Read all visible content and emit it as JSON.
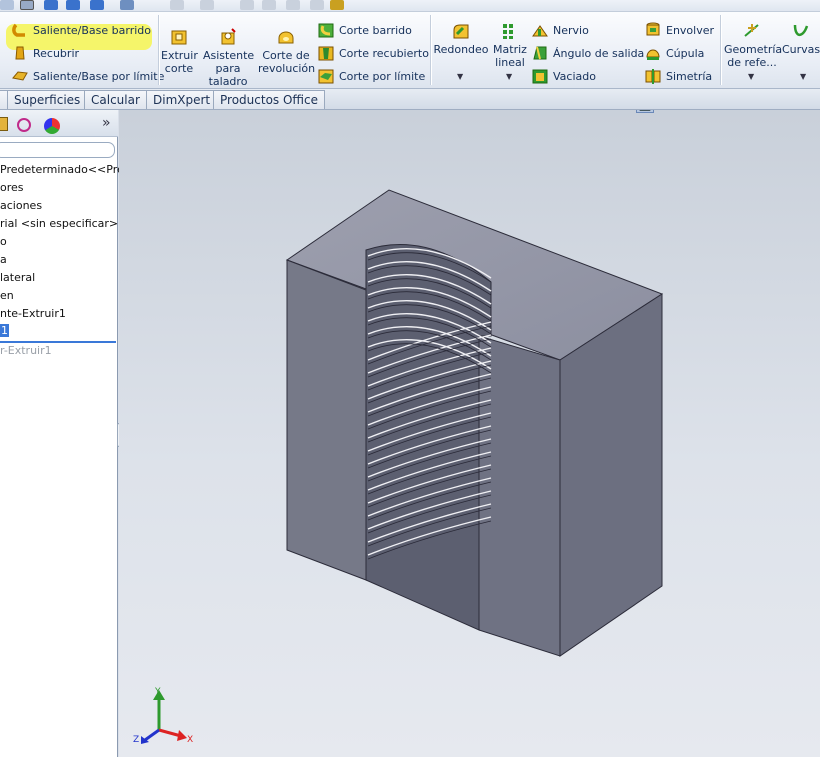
{
  "ribbon": {
    "sweep_boss": "Saliente/Base barrido",
    "loft_boss": "Recubrir",
    "boundary_boss": "Saliente/Base por límite",
    "extrude_cut": [
      "Extruir",
      "corte"
    ],
    "hole_wizard": [
      "Asistente",
      "para",
      "taladro"
    ],
    "revolve_cut": [
      "Corte de",
      "revolución"
    ],
    "swept_cut": "Corte barrido",
    "lofted_cut": "Corte recubierto",
    "boundary_cut": "Corte por límite",
    "fillet": "Redondeo",
    "linear_pattern": [
      "Matriz",
      "lineal"
    ],
    "rib": "Nervio",
    "draft": "Ángulo de salida",
    "shell": "Vaciado",
    "wrap": "Envolver",
    "dome": "Cúpula",
    "mirror": "Simetría",
    "ref_geometry": [
      "Geometría",
      "de refe..."
    ],
    "curves": "Curvas"
  },
  "tabs": [
    "Superficies",
    "Calcular",
    "DimXpert",
    "Productos Office"
  ],
  "panel": {
    "more": "»",
    "tree": [
      "Predeterminado<<Pred",
      "ores",
      "aciones",
      "rial <sin especificar>",
      "o",
      "a",
      "lateral",
      "en",
      "nte-Extruir1",
      "1",
      "r-Extruir1"
    ],
    "splitter": "‹"
  },
  "triad": {
    "x": "X",
    "y": "Y",
    "z": "Z"
  },
  "colors": {
    "highlight": "#f5f56a",
    "viewport_top": "#c9d0da",
    "part_side": "#6f7283",
    "part_top": "#999cab",
    "selection": "#3a78d8"
  }
}
